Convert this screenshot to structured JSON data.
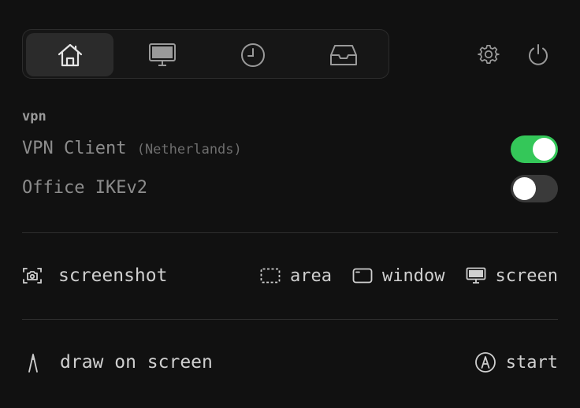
{
  "tabs": [
    {
      "icon": "home-icon",
      "active": true
    },
    {
      "icon": "monitor-icon",
      "active": false
    },
    {
      "icon": "clock-icon",
      "active": false
    },
    {
      "icon": "inbox-icon",
      "active": false
    }
  ],
  "header_icons": [
    "settings-icon",
    "power-icon"
  ],
  "vpn": {
    "section_label": "vpn",
    "items": [
      {
        "name": "VPN Client",
        "location": "(Netherlands)",
        "enabled": true
      },
      {
        "name": "Office IKEv2",
        "location": "",
        "enabled": false
      }
    ]
  },
  "screenshot": {
    "label": "screenshot",
    "actions": [
      {
        "label": "area",
        "icon": "dashed-rectangle-icon"
      },
      {
        "label": "window",
        "icon": "window-icon"
      },
      {
        "label": "screen",
        "icon": "display-icon"
      }
    ]
  },
  "draw": {
    "label": "draw on screen",
    "action_label": "start",
    "action_icon": "circled-a-icon"
  },
  "colors": {
    "background": "#111111",
    "toggle_on": "#34c759",
    "toggle_off": "#3a3a3a",
    "text": "#d0d0d0",
    "muted_text": "#8c8c8c"
  }
}
